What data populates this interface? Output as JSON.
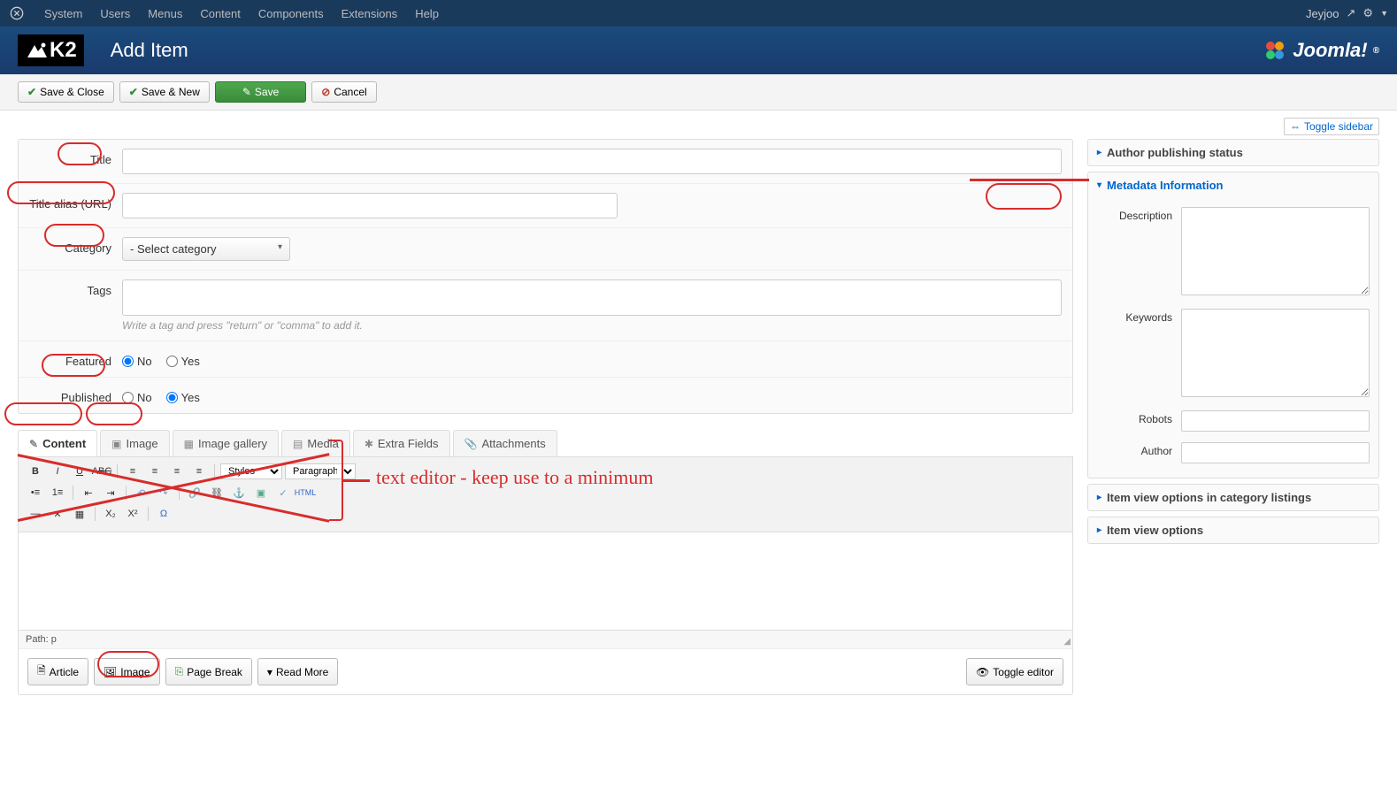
{
  "topnav": {
    "items": [
      "System",
      "Users",
      "Menus",
      "Content",
      "Components",
      "Extensions",
      "Help"
    ],
    "user": "Jeyjoo"
  },
  "header": {
    "k2_label": "K2",
    "page_title": "Add Item",
    "brand": "Joomla!"
  },
  "toolbar": {
    "save_close": "Save & Close",
    "save_new": "Save & New",
    "save": "Save",
    "cancel": "Cancel"
  },
  "toggle_sidebar": "Toggle sidebar",
  "form": {
    "title_label": "Title",
    "title_value": "",
    "alias_label": "Title alias (URL)",
    "alias_value": "",
    "category_label": "Category",
    "category_value": "- Select category",
    "tags_label": "Tags",
    "tags_help": "Write a tag and press \"return\" or \"comma\" to add it.",
    "featured_label": "Featured",
    "published_label": "Published",
    "no": "No",
    "yes": "Yes"
  },
  "tabs": [
    "Content",
    "Image",
    "Image gallery",
    "Media",
    "Extra Fields",
    "Attachments"
  ],
  "editor": {
    "styles": "Styles",
    "paragraph": "Paragraph",
    "path": "Path: p",
    "html": "HTML"
  },
  "editor_footer": {
    "article": "Article",
    "image": "Image",
    "page_break": "Page Break",
    "read_more": "Read More",
    "toggle_editor": "Toggle editor"
  },
  "sidebar": {
    "panels": {
      "publishing": "Author publishing status",
      "metadata": "Metadata Information",
      "view_cat": "Item view options in category listings",
      "view": "Item view options"
    },
    "meta": {
      "description": "Description",
      "keywords": "Keywords",
      "robots": "Robots",
      "author": "Author"
    }
  },
  "annotation": {
    "text": "text editor - keep use to a minimum"
  }
}
